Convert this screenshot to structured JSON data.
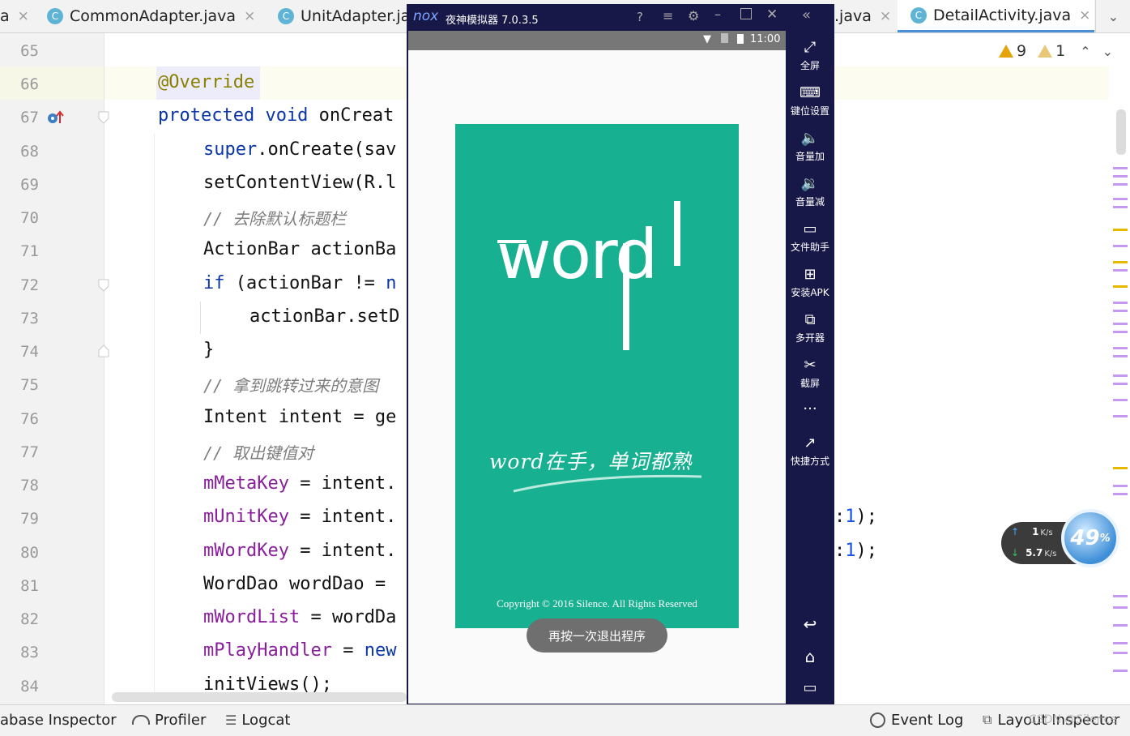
{
  "tabs": {
    "partial_left": "a",
    "common": "CommonAdapter.java",
    "unit": "UnitAdapter.ja",
    "hidden_java": ".java",
    "detail": "DetailActivity.java",
    "c_icon": "C",
    "close_icon": "×"
  },
  "inspections": {
    "warnings": "9",
    "weak_warnings": "1",
    "warning_color": "#e5a50a"
  },
  "lines": {
    "n65": "65",
    "n66": "66",
    "n67": "67",
    "n68": "68",
    "n69": "69",
    "n70": "70",
    "n71": "71",
    "n72": "72",
    "n73": "73",
    "n74": "74",
    "n75": "75",
    "n76": "76",
    "n77": "77",
    "n78": "78",
    "n79": "79",
    "n80": "80",
    "n81": "81",
    "n82": "82",
    "n83": "83",
    "n84": "84"
  },
  "code": {
    "l66": "@Override",
    "l67_kw": "protected void",
    "l67_rest": " onCreat",
    "l68_kw": "super",
    "l68_rest": ".onCreate(sav",
    "l69": "setContentView(R.l",
    "l70": "// 去除默认标题栏",
    "l71": "ActionBar actionBa",
    "l72_kw": "if",
    "l72_rest": " (actionBar != ",
    "l72_tail": "n",
    "l73": "actionBar.setD",
    "l74": "}",
    "l75": "// 拿到跳转过来的意图",
    "l76": "Intent intent = ge",
    "l77": "// 取出键值对",
    "l78_fld": "mMetaKey",
    "l78_rest": " = intent.",
    "l79_fld": "mUnitKey",
    "l79_rest": " = intent.",
    "l80_fld": "mWordKey",
    "l80_rest": " = intent.",
    "l81": "WordDao wordDao = ",
    "l82_fld": "mWordList",
    "l82_rest": " = wordDa",
    "l83_fld": "mPlayHandler",
    "l83_rest": " = ",
    "l83_kw": "new",
    "l84": "initViews();",
    "r79_colon": ":",
    "r79_num": "1",
    "r79_end": ");",
    "r80_colon": ":",
    "r80_num": "1",
    "r80_end": ");"
  },
  "emulator": {
    "brand": "nox",
    "title": "夜神模拟器 7.0.3.5",
    "time": "11:00",
    "app_logo": "word",
    "slogan": "word在手，单词都熟",
    "copyright": "Copyright © 2016 Silence. All Rights Reserved",
    "toast": "再按一次退出程序",
    "sidebar": [
      {
        "icon": "fullscreen-icon",
        "glyph": "⤢",
        "label": "全屏"
      },
      {
        "icon": "keyboard-icon",
        "glyph": "⌨",
        "label": "键位设置"
      },
      {
        "icon": "volume-up-icon",
        "glyph": "🔈",
        "label": "音量加"
      },
      {
        "icon": "volume-down-icon",
        "glyph": "🔉",
        "label": "音量减"
      },
      {
        "icon": "file-assistant-icon",
        "glyph": "▭",
        "label": "文件助手"
      },
      {
        "icon": "install-apk-icon",
        "glyph": "⊞",
        "label": "安装APK"
      },
      {
        "icon": "multi-instance-icon",
        "glyph": "⧉",
        "label": "多开器"
      },
      {
        "icon": "screenshot-icon",
        "glyph": "✂",
        "label": "截屏"
      },
      {
        "icon": "more-icon",
        "glyph": "···",
        "label": ""
      },
      {
        "icon": "shortcut-icon",
        "glyph": "↗",
        "label": "快捷方式"
      }
    ],
    "nav": {
      "back": "↩",
      "home": "⌂",
      "recent": "▭"
    },
    "splash_color": "#17b091",
    "frame_color": "#181848"
  },
  "net_widget": {
    "up": "1",
    "up_unit": "K/s",
    "down": "5.7",
    "down_unit": "K/s",
    "percent": "49",
    "percent_sign": "%"
  },
  "bottom_bar": {
    "db_inspector": "abase Inspector",
    "profiler": "Profiler",
    "logcat": "Logcat",
    "event_log": "Event Log",
    "layout_inspector": "Layout Inspector"
  },
  "watermark": "CSDN @Silence"
}
